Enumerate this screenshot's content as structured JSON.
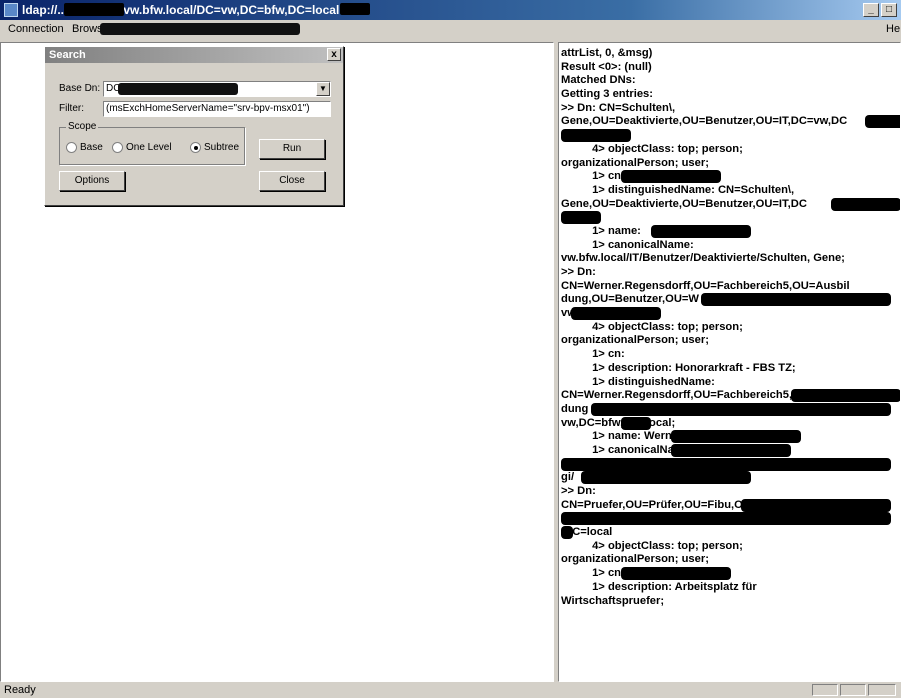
{
  "window": {
    "title": "ldap://...V-DOM01.vw.bfw.local/DC=vw,DC=bfw,DC=local",
    "minimize": "_",
    "maximize": "□"
  },
  "menu": {
    "connection": "Connection",
    "browse": "Browse",
    "help": "He"
  },
  "search_dialog": {
    "title": "Search",
    "close": "x",
    "base_dn_label": "Base Dn:",
    "base_dn_value": "DC",
    "filter_label": "Filter:",
    "filter_value": "(msExchHomeServerName=\"srv-bpv-msx01\")",
    "scope_label": "Scope",
    "scope_base": "Base",
    "scope_one_level": "One Level",
    "scope_subtree": "Subtree",
    "scope_selected": "Subtree",
    "run": "Run",
    "options": "Options",
    "close_button": "Close"
  },
  "log": [
    "attrList, 0, &msg)",
    "Result <0>: (null)",
    "Matched DNs:",
    "Getting 3 entries:",
    ">> Dn: CN=Schulten\\,",
    "Gene,OU=Deaktivierte,OU=Benutzer,OU=IT,DC=vw,DC",
    "",
    "          4> objectClass: top; person;",
    "organizationalPerson; user;",
    "          1> cn:",
    "          1> distinguishedName: CN=Schulten\\,",
    "Gene,OU=Deaktivierte,OU=Benutzer,OU=IT,DC",
    "",
    "          1> name:",
    "          1> canonicalName:",
    "vw.bfw.local/IT/Benutzer/Deaktivierte/Schulten, Gene;",
    ">> Dn:",
    "CN=Werner.Regensdorff,OU=Fachbereich5,OU=Ausbil",
    "dung,OU=Benutzer,OU=W",
    "vw",
    "          4> objectClass: top; person;",
    "organizationalPerson; user;",
    "          1> cn:",
    "          1> description: Honorarkraft - FBS TZ;",
    "          1> distinguishedName:",
    "CN=Werner.Regensdorff,OU=Fachbereich5,OU",
    "dung",
    "vw,DC=bfw,DC=local;",
    "          1> name: Werner",
    "          1> canonicalName:",
    "",
    "gi/                              nsdorff;",
    ">> Dn:",
    "CN=Pruefer,OU=Prüfer,OU=Fibu,OU=",
    "",
    ",DC=local",
    "          4> objectClass: top; person;",
    "organizationalPerson; user;",
    "          1> cn:",
    "          1> description: Arbeitsplatz für",
    "Wirtschaftspruefer;"
  ],
  "status": {
    "text": "Ready"
  }
}
